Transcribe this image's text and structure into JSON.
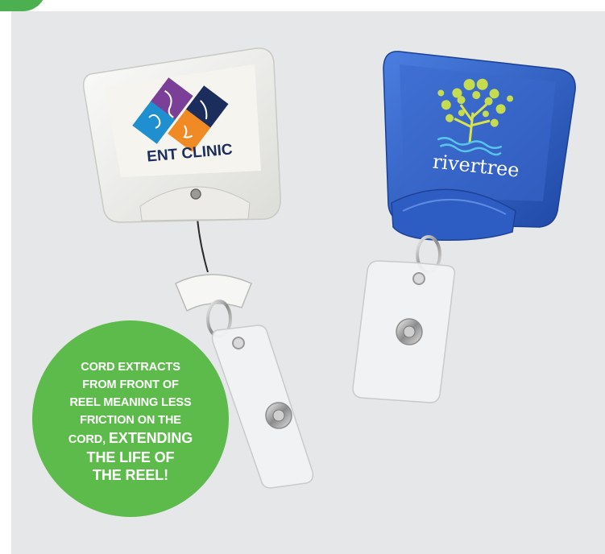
{
  "badges": {
    "left": {
      "brand_text": "ENT CLINIC"
    },
    "right": {
      "brand_text": "rivertree"
    }
  },
  "callout": {
    "lines": [
      {
        "text": "CORD EXTRACTS",
        "emphasis": false
      },
      {
        "text": "FROM FRONT OF",
        "emphasis": false
      },
      {
        "text": "REEL MEANING LESS",
        "emphasis": false
      },
      {
        "text": "FRICTION ON THE",
        "emphasis": false
      }
    ],
    "mixed_line": {
      "normal": "CORD, ",
      "emphasis": "EXTENDING"
    },
    "tail_lines": [
      "THE LIFE OF",
      "THE REEL!"
    ]
  },
  "colors": {
    "accent_green": "#5dbb4b",
    "reel_blue": "#2f5fc4",
    "reel_white": "#f2f2f0"
  }
}
